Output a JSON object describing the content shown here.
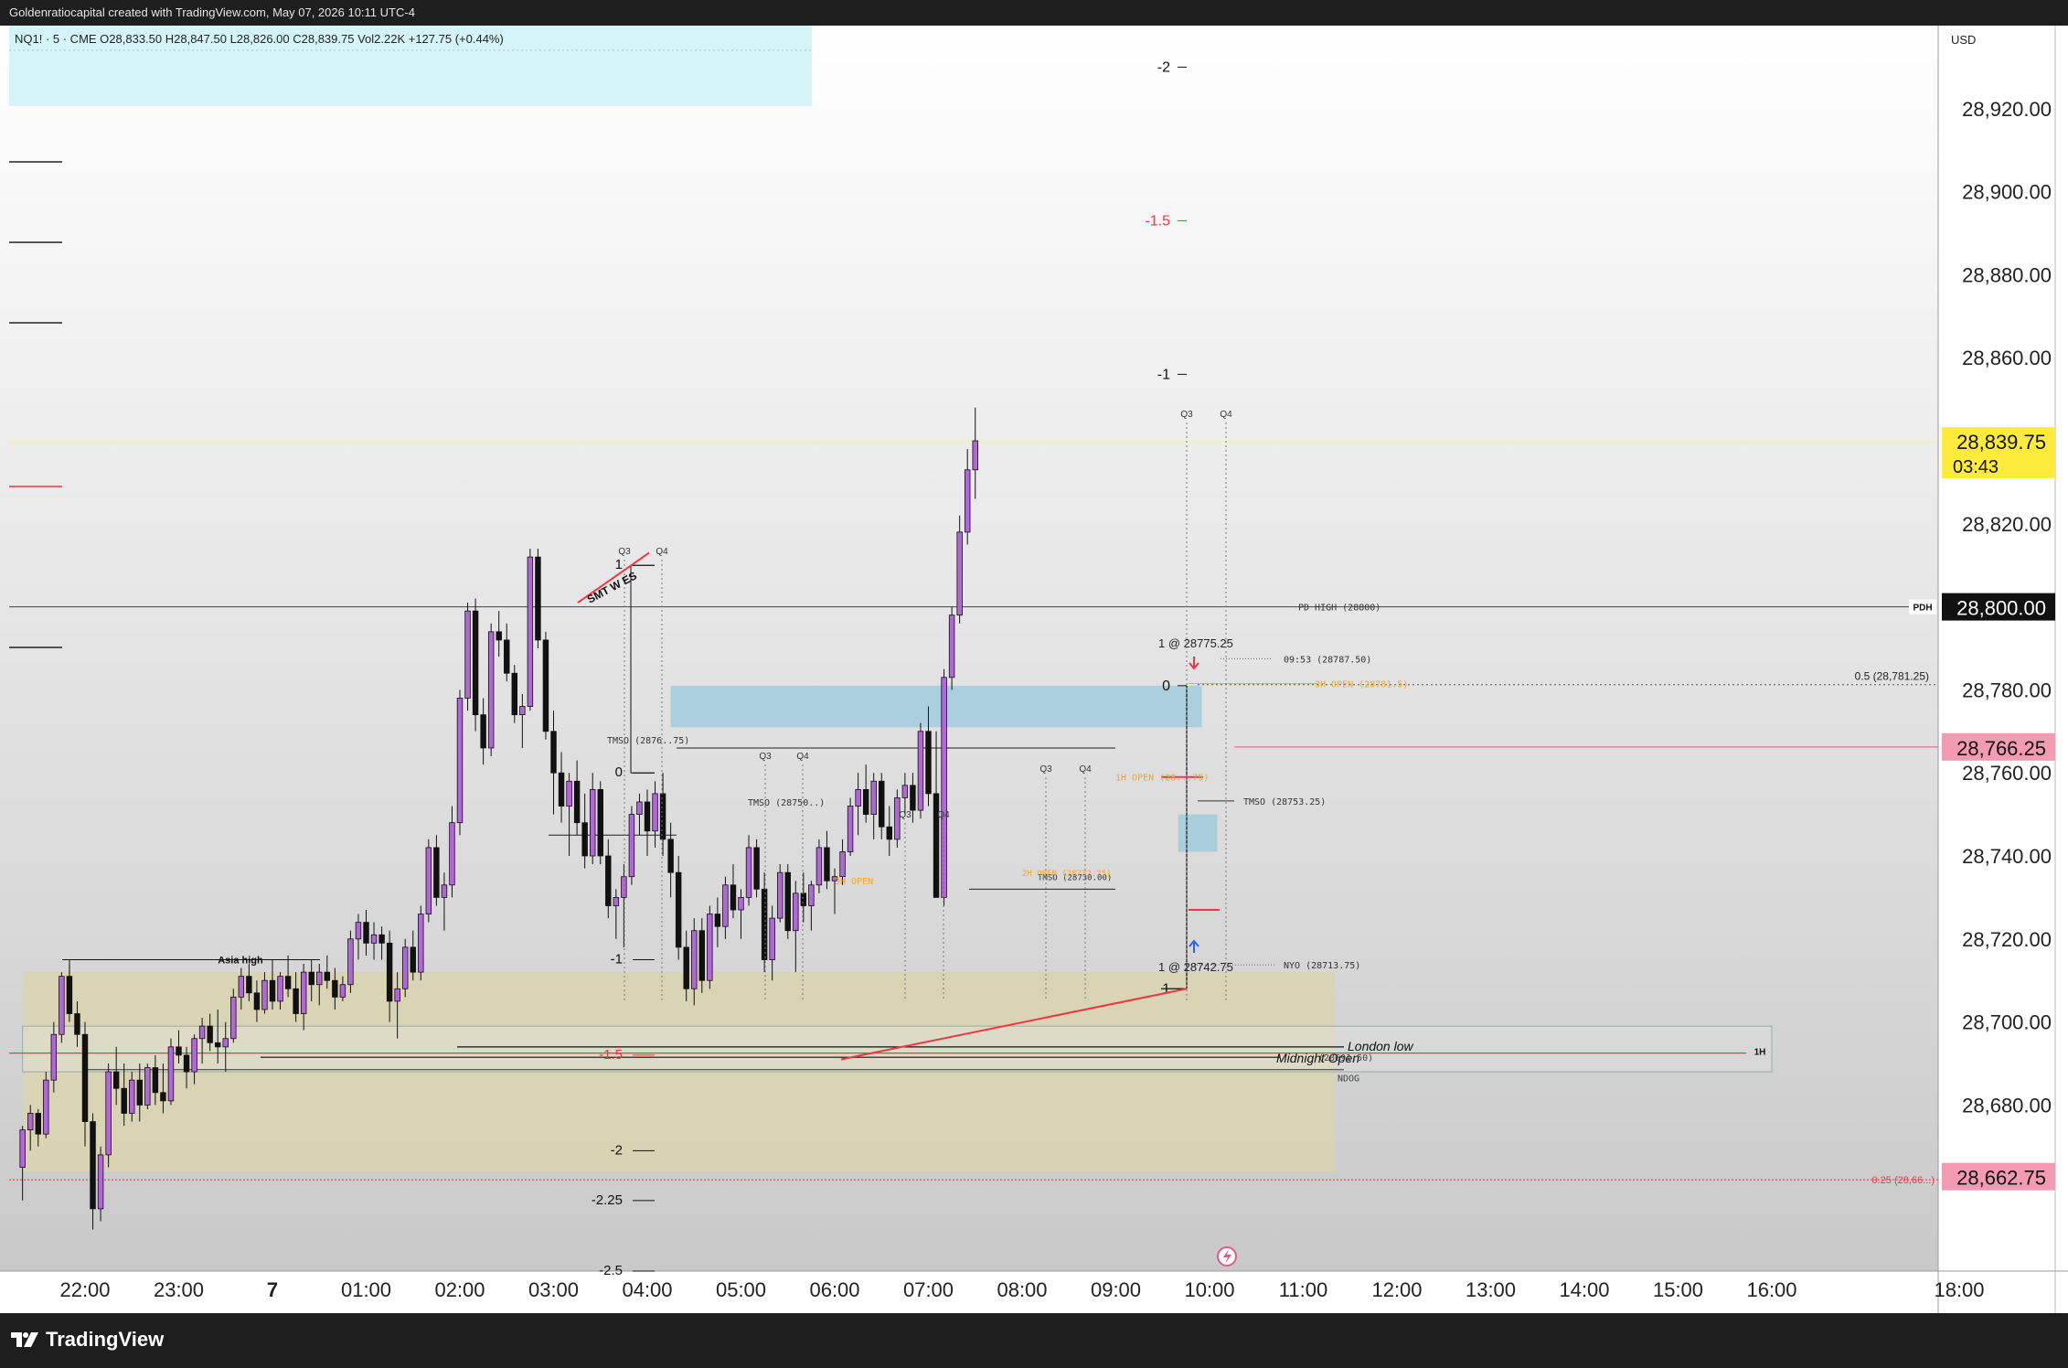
{
  "header": {
    "caption": "Goldenratiocapital created with TradingView.com, May 07, 2026 10:11 UTC-4"
  },
  "legend": {
    "text": "NQ1! · 5 · CME  O28,833.50  H28,847.50  L28,826.00  C28,839.75  Vol2.22K  +127.75 (+0.44%)"
  },
  "footer": {
    "brand": "TradingView"
  },
  "colors": {
    "bull": "#b266d8",
    "bear": "#111111",
    "price_label_bg": "#ffeb3b",
    "red": "#f23645",
    "pink": "#e05a86",
    "orange": "#f5a623",
    "asia_zone": "#d9d4b0",
    "fvg": "#9ccbdc",
    "legend_bg": "#d5f4f8"
  },
  "chart_data": {
    "type": "candlestick",
    "symbol": "NQ1!",
    "timeframe": "5",
    "exchange": "CME",
    "currency_label": "USD",
    "ylim": [
      28640,
      28940
    ],
    "y_ticks": [
      {
        "value": 28920,
        "label": "28,920.00"
      },
      {
        "value": 28900,
        "label": "28,900.00"
      },
      {
        "value": 28880,
        "label": "28,880.00"
      },
      {
        "value": 28860,
        "label": "28,860.00"
      },
      {
        "value": 28820,
        "label": "28,820.00"
      },
      {
        "value": 28780,
        "label": "28,780.00"
      },
      {
        "value": 28760,
        "label": "28,760.00"
      },
      {
        "value": 28740,
        "label": "28,740.00"
      },
      {
        "value": 28720,
        "label": "28,720.00"
      },
      {
        "value": 28700,
        "label": "28,700.00"
      },
      {
        "value": 28680,
        "label": "28,680.00"
      }
    ],
    "x_ticks": [
      {
        "time": "2026-05-06 22:00",
        "label": "22:00"
      },
      {
        "time": "2026-05-06 23:00",
        "label": "23:00"
      },
      {
        "time": "2026-05-07 00:00",
        "label": "7"
      },
      {
        "time": "2026-05-07 01:00",
        "label": "01:00"
      },
      {
        "time": "2026-05-07 02:00",
        "label": "02:00"
      },
      {
        "time": "2026-05-07 03:00",
        "label": "03:00"
      },
      {
        "time": "2026-05-07 04:00",
        "label": "04:00"
      },
      {
        "time": "2026-05-07 05:00",
        "label": "05:00"
      },
      {
        "time": "2026-05-07 06:00",
        "label": "06:00"
      },
      {
        "time": "2026-05-07 07:00",
        "label": "07:00"
      },
      {
        "time": "2026-05-07 08:00",
        "label": "08:00"
      },
      {
        "time": "2026-05-07 09:00",
        "label": "09:00"
      },
      {
        "time": "2026-05-07 10:00",
        "label": "10:00"
      },
      {
        "time": "2026-05-07 11:00",
        "label": "11:00"
      },
      {
        "time": "2026-05-07 12:00",
        "label": "12:00"
      },
      {
        "time": "2026-05-07 13:00",
        "label": "13:00"
      },
      {
        "time": "2026-05-07 14:00",
        "label": "14:00"
      },
      {
        "time": "2026-05-07 15:00",
        "label": "15:00"
      },
      {
        "time": "2026-05-07 16:00",
        "label": "16:00"
      },
      {
        "time": "2026-05-07 18:00",
        "label": "18:00"
      }
    ],
    "candles": {
      "start": "2026-05-06 21:20",
      "interval_minutes": 5,
      "ohlc": [
        [
          28665,
          28675,
          28657,
          28674
        ],
        [
          28674,
          28680,
          28669,
          28678
        ],
        [
          28678,
          28679,
          28670,
          28673
        ],
        [
          28673,
          28688,
          28672,
          28686
        ],
        [
          28686,
          28700,
          28683,
          28697
        ],
        [
          28697,
          28712,
          28695,
          28711
        ],
        [
          28711,
          28714,
          28700,
          28702
        ],
        [
          28702,
          28705,
          28694,
          28697
        ],
        [
          28697,
          28700,
          28670,
          28676
        ],
        [
          28676,
          28678,
          28650,
          28655
        ],
        [
          28655,
          28670,
          28652,
          28668
        ],
        [
          28668,
          28690,
          28665,
          28688
        ],
        [
          28688,
          28694,
          28680,
          28684
        ],
        [
          28684,
          28690,
          28675,
          28678
        ],
        [
          28678,
          28688,
          28676,
          28686
        ],
        [
          28686,
          28690,
          28676,
          28680
        ],
        [
          28680,
          28690,
          28679,
          28689
        ],
        [
          28689,
          28692,
          28680,
          28683
        ],
        [
          28683,
          28690,
          28678,
          28681
        ],
        [
          28681,
          28696,
          28680,
          28694
        ],
        [
          28694,
          28698,
          28690,
          28692
        ],
        [
          28692,
          28694,
          28684,
          28688
        ],
        [
          28688,
          28697,
          28685,
          28696
        ],
        [
          28696,
          28701,
          28690,
          28699
        ],
        [
          28699,
          28702,
          28693,
          28695
        ],
        [
          28695,
          28703,
          28690,
          28694
        ],
        [
          28694,
          28700,
          28688,
          28696
        ],
        [
          28696,
          28708,
          28695,
          28706
        ],
        [
          28706,
          28713,
          28703,
          28711
        ],
        [
          28711,
          28714,
          28705,
          28707
        ],
        [
          28707,
          28710,
          28700,
          28703
        ],
        [
          28703,
          28712,
          28702,
          28710
        ],
        [
          28710,
          28715,
          28703,
          28705
        ],
        [
          28705,
          28712,
          28703,
          28711
        ],
        [
          28711,
          28716,
          28706,
          28708
        ],
        [
          28708,
          28712,
          28700,
          28702
        ],
        [
          28702,
          28714,
          28698,
          28712
        ],
        [
          28712,
          28715,
          28705,
          28709
        ],
        [
          28709,
          28714,
          28704,
          28712
        ],
        [
          28712,
          28716,
          28708,
          28710
        ],
        [
          28710,
          28713,
          28703,
          28706
        ],
        [
          28706,
          28711,
          28705,
          28709
        ],
        [
          28709,
          28722,
          28707,
          28720
        ],
        [
          28720,
          28726,
          28715,
          28724
        ],
        [
          28724,
          28727,
          28716,
          28719
        ],
        [
          28719,
          28724,
          28715,
          28721
        ],
        [
          28721,
          28723,
          28715,
          28719
        ],
        [
          28719,
          28722,
          28700,
          28705
        ],
        [
          28705,
          28712,
          28696,
          28708
        ],
        [
          28708,
          28720,
          28706,
          28718
        ],
        [
          28718,
          28722,
          28710,
          28712
        ],
        [
          28712,
          28728,
          28710,
          28726
        ],
        [
          28726,
          28744,
          28724,
          28742
        ],
        [
          28742,
          28745,
          28728,
          28730
        ],
        [
          28730,
          28736,
          28722,
          28733
        ],
        [
          28733,
          28752,
          28730,
          28748
        ],
        [
          28748,
          28780,
          28745,
          28778
        ],
        [
          28778,
          28801,
          28775,
          28799
        ],
        [
          28799,
          28802,
          28770,
          28774
        ],
        [
          28774,
          28778,
          28762,
          28766
        ],
        [
          28766,
          28796,
          28764,
          28794
        ],
        [
          28794,
          28799,
          28788,
          28792
        ],
        [
          28792,
          28796,
          28782,
          28784
        ],
        [
          28784,
          28786,
          28772,
          28774
        ],
        [
          28774,
          28779,
          28766,
          28776
        ],
        [
          28776,
          28814,
          28775,
          28812
        ],
        [
          28812,
          28814,
          28790,
          28792
        ],
        [
          28792,
          28794,
          28768,
          28770
        ],
        [
          28770,
          28775,
          28750,
          28760
        ],
        [
          28760,
          28765,
          28748,
          28752
        ],
        [
          28752,
          28760,
          28740,
          28758
        ],
        [
          28758,
          28763,
          28745,
          28748
        ],
        [
          28748,
          28755,
          28737,
          28740
        ],
        [
          28740,
          28760,
          28738,
          28756
        ],
        [
          28756,
          28758,
          28738,
          28740
        ],
        [
          28740,
          28744,
          28725,
          28728
        ],
        [
          28728,
          28732,
          28720,
          28730
        ],
        [
          28730,
          28738,
          28718,
          28735
        ],
        [
          28735,
          28752,
          28733,
          28750
        ],
        [
          28750,
          28755,
          28745,
          28753
        ],
        [
          28753,
          28756,
          28740,
          28746
        ],
        [
          28746,
          28758,
          28742,
          28755
        ],
        [
          28755,
          28760,
          28740,
          28744
        ],
        [
          28744,
          28748,
          28730,
          28736
        ],
        [
          28736,
          28740,
          28715,
          28718
        ],
        [
          28718,
          28722,
          28705,
          28708
        ],
        [
          28708,
          28725,
          28704,
          28722
        ],
        [
          28722,
          28725,
          28707,
          28710
        ],
        [
          28710,
          28728,
          28708,
          28726
        ],
        [
          28726,
          28730,
          28718,
          28723
        ],
        [
          28723,
          28735,
          28720,
          28733
        ],
        [
          28733,
          28738,
          28725,
          28727
        ],
        [
          28727,
          28732,
          28720,
          28730
        ],
        [
          28730,
          28745,
          28728,
          28742
        ],
        [
          28742,
          28744,
          28730,
          28732
        ],
        [
          28732,
          28736,
          28712,
          28715
        ],
        [
          28715,
          28728,
          28710,
          28725
        ],
        [
          28725,
          28738,
          28724,
          28736
        ],
        [
          28736,
          28738,
          28720,
          28722
        ],
        [
          28722,
          28734,
          28712,
          28731
        ],
        [
          28731,
          28736,
          28724,
          28728
        ],
        [
          28728,
          28734,
          28722,
          28733
        ],
        [
          28733,
          28744,
          28731,
          28742
        ],
        [
          28742,
          28746,
          28732,
          28734
        ],
        [
          28734,
          28737,
          28726,
          28735
        ],
        [
          28735,
          28744,
          28733,
          28741
        ],
        [
          28741,
          28754,
          28740,
          28752
        ],
        [
          28752,
          28760,
          28745,
          28756
        ],
        [
          28756,
          28762,
          28748,
          28750
        ],
        [
          28750,
          28760,
          28744,
          28758
        ],
        [
          28758,
          28760,
          28744,
          28747
        ],
        [
          28747,
          28752,
          28740,
          28744
        ],
        [
          28744,
          28756,
          28742,
          28754
        ],
        [
          28754,
          28760,
          28750,
          28757
        ],
        [
          28757,
          28760,
          28748,
          28751
        ],
        [
          28751,
          28772,
          28749,
          28770
        ],
        [
          28770,
          28776,
          28752,
          28755
        ],
        [
          28755,
          28770,
          28740,
          28730
        ],
        [
          28730,
          28785,
          28728,
          28783
        ],
        [
          28783,
          28800,
          28780,
          28798
        ],
        [
          28798,
          28822,
          28796,
          28818
        ],
        [
          28818,
          28838,
          28815,
          28833
        ],
        [
          28833,
          28848,
          28826,
          28840
        ]
      ]
    },
    "price_labels": [
      {
        "value": 28839.75,
        "text": "28,839.75",
        "sub": "03:43",
        "style": "current"
      },
      {
        "value": 28800,
        "text": "28,800.00",
        "style": "black"
      },
      {
        "value": 28766.25,
        "text": "28,766.25",
        "style": "pink"
      },
      {
        "value": 28662.75,
        "text": "28,662.75",
        "style": "pink"
      }
    ],
    "zones": [
      {
        "name": "asia-range-zone",
        "y1": 28664,
        "y2": 28712,
        "t1": "2026-05-06 21:20",
        "t2": "2026-05-07 11:20"
      },
      {
        "name": "fvg-zone-1",
        "y1": 28771,
        "y2": 28781,
        "t1": "2026-05-07 04:15",
        "t2": "2026-05-07 09:55"
      },
      {
        "name": "fvg-zone-2",
        "y1": 28741,
        "y2": 28750,
        "t1": "2026-05-07 09:40",
        "t2": "2026-05-07 10:05"
      },
      {
        "name": "1h-box",
        "y1": 28688,
        "y2": 28699,
        "t1": "2026-05-06 21:20",
        "t2": "2026-05-07 16:00"
      }
    ],
    "levels": [
      {
        "name": "pd-high",
        "value": 28800,
        "label": "PD HIGH (28800)",
        "tag": "PDH",
        "color": "#555555"
      },
      {
        "name": "fib-0.5",
        "value": 28781.25,
        "label": "0.5 (28,781.25)",
        "color": "#555555"
      },
      {
        "name": "3h-open",
        "value": 28781.5,
        "label": "3H OPEN (28781.5)",
        "color": "#f5a623"
      },
      {
        "name": "0953",
        "value": 28787.5,
        "label": "09:53 (28787.50)",
        "color": "#555555"
      },
      {
        "name": "tmso",
        "value": 28753.25,
        "label": "TMSO (28753.25)",
        "color": "#333333"
      },
      {
        "name": "nyo",
        "value": 28713.75,
        "label": "NYO (28713.75)",
        "color": "#555555"
      },
      {
        "name": "london-low",
        "value": 28694,
        "label": "London low",
        "color": "#111111"
      },
      {
        "name": "midnight-open",
        "value": 28691.5,
        "label": "Midnight Open",
        "sub": "(28691.50)",
        "color": "#111111"
      },
      {
        "name": "fib-0.25",
        "value": 28662,
        "label": "0.25 (28,66...)",
        "color": "#f23645"
      },
      {
        "name": "asia-high",
        "value": 28715,
        "label": "Asia high",
        "color": "#111111"
      }
    ],
    "annotations": {
      "fib_left": [
        {
          "value": 28760,
          "text": "0"
        },
        {
          "value": 28810,
          "text": "1"
        },
        {
          "value": 28715,
          "text": "-1"
        },
        {
          "value": 28692,
          "text": "-1.5",
          "color": "#f23645"
        },
        {
          "value": 28669,
          "text": "-2"
        },
        {
          "value": 28657,
          "text": "-2.25"
        },
        {
          "value": 28640,
          "text": "-2.5"
        }
      ],
      "fib_right": [
        {
          "value": 28781,
          "text": "0"
        },
        {
          "value": 28708,
          "text": "1"
        },
        {
          "value": 28856,
          "text": "-1"
        },
        {
          "value": 28893,
          "text": "-1.5",
          "color": "#f23645"
        },
        {
          "value": 28930,
          "text": "-2"
        }
      ],
      "smt": "SMT W ES",
      "trade_top": "1 @ 28775.25",
      "trade_bottom": "1 @ 28742.75",
      "q_labels": [
        "Q3",
        "Q4"
      ],
      "small_labels": {
        "tmso_1": "TMSO (2876..75)",
        "tmso_2": "TMSO (28750..)",
        "tmso_3": "TMSO (28730.00)",
        "ndog": "NDOG",
        "oneh": "1H",
        "h1_open": "1H OPEN (28...75)",
        "h3_open_2": "3H OPEN",
        "h2_open": "2H OPEN (28732.25)"
      }
    }
  }
}
